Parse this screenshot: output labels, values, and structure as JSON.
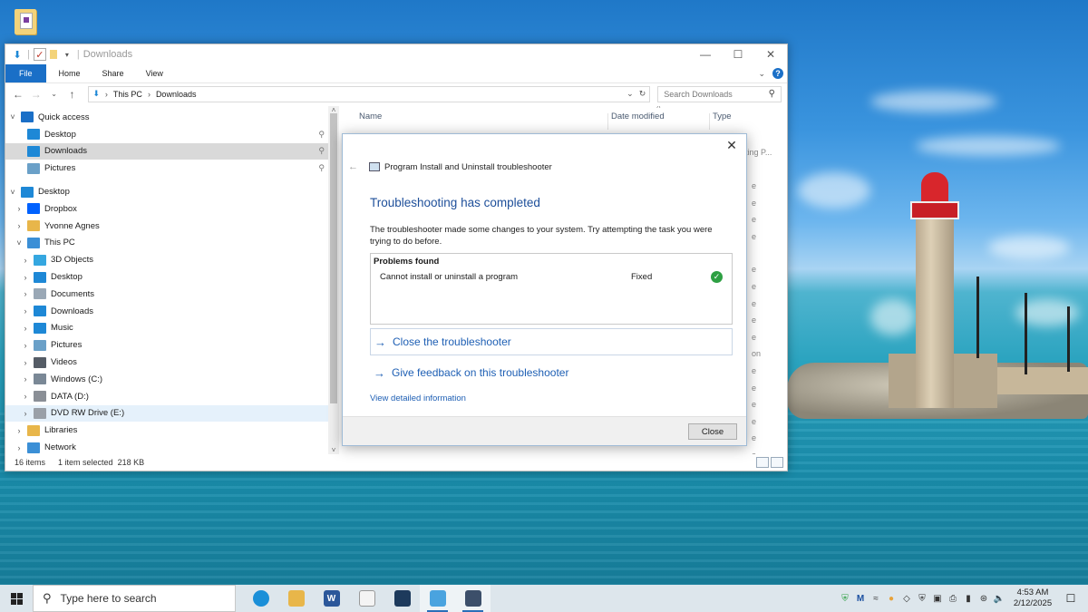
{
  "explorer": {
    "title": "Downloads",
    "ribbon_tabs": [
      "File",
      "Home",
      "Share",
      "View"
    ],
    "breadcrumb": [
      "This PC",
      "Downloads"
    ],
    "search_placeholder": "Search Downloads",
    "nav_items": [
      {
        "label": "Quick access",
        "icon": "star-icon",
        "color": "#1a6fc7",
        "indent": 0,
        "chevron": "v",
        "state": ""
      },
      {
        "label": "Desktop",
        "icon": "desktop-icon",
        "color": "#1e88d6",
        "indent": 1,
        "chevron": "",
        "state": "",
        "pinned": true
      },
      {
        "label": "Downloads",
        "icon": "download-icon",
        "color": "#1e88d6",
        "indent": 1,
        "chevron": "",
        "state": "selected",
        "pinned": true
      },
      {
        "label": "Pictures",
        "icon": "pictures-icon",
        "color": "#6aa0c8",
        "indent": 1,
        "chevron": "",
        "state": "",
        "pinned": true
      },
      {
        "label": "Desktop",
        "icon": "desktop-icon",
        "color": "#1e88d6",
        "indent": 0,
        "chevron": "v",
        "state": ""
      },
      {
        "label": "Dropbox",
        "icon": "dropbox-icon",
        "color": "#0061fe",
        "indent": 1,
        "chevron": ">",
        "state": ""
      },
      {
        "label": "Yvonne Agnes",
        "icon": "user-folder-icon",
        "color": "#e8b64a",
        "indent": 1,
        "chevron": ">",
        "state": ""
      },
      {
        "label": "This PC",
        "icon": "computer-icon",
        "color": "#3b8fd6",
        "indent": 1,
        "chevron": "v",
        "state": ""
      },
      {
        "label": "3D Objects",
        "icon": "cube-icon",
        "color": "#35a7e0",
        "indent": 2,
        "chevron": ">",
        "state": ""
      },
      {
        "label": "Desktop",
        "icon": "desktop-icon",
        "color": "#1e88d6",
        "indent": 2,
        "chevron": ">",
        "state": ""
      },
      {
        "label": "Documents",
        "icon": "documents-icon",
        "color": "#9aa8b6",
        "indent": 2,
        "chevron": ">",
        "state": ""
      },
      {
        "label": "Downloads",
        "icon": "download-icon",
        "color": "#1e88d6",
        "indent": 2,
        "chevron": ">",
        "state": ""
      },
      {
        "label": "Music",
        "icon": "music-icon",
        "color": "#1e88d6",
        "indent": 2,
        "chevron": ">",
        "state": ""
      },
      {
        "label": "Pictures",
        "icon": "pictures-icon",
        "color": "#6aa0c8",
        "indent": 2,
        "chevron": ">",
        "state": ""
      },
      {
        "label": "Videos",
        "icon": "videos-icon",
        "color": "#555c66",
        "indent": 2,
        "chevron": ">",
        "state": ""
      },
      {
        "label": "Windows (C:)",
        "icon": "drive-icon",
        "color": "#7a8896",
        "indent": 2,
        "chevron": ">",
        "state": ""
      },
      {
        "label": "DATA (D:)",
        "icon": "drive-icon",
        "color": "#8a8f96",
        "indent": 2,
        "chevron": ">",
        "state": ""
      },
      {
        "label": "DVD RW Drive (E:)",
        "icon": "dvd-drive-icon",
        "color": "#9aa0a8",
        "indent": 2,
        "chevron": ">",
        "state": "hover"
      },
      {
        "label": "Libraries",
        "icon": "libraries-icon",
        "color": "#e8b64a",
        "indent": 1,
        "chevron": ">",
        "state": ""
      },
      {
        "label": "Network",
        "icon": "network-icon",
        "color": "#3b8fd6",
        "indent": 1,
        "chevron": ">",
        "state": ""
      }
    ],
    "columns": [
      "Name",
      "Date modified",
      "Type"
    ],
    "partial_type_text": "oting P...",
    "partial_type_glyphs": [
      "e",
      "e",
      "e",
      "e",
      "e",
      "e",
      "e",
      "e",
      "e",
      "on",
      "e",
      "e",
      "e",
      "e",
      "e",
      "e",
      "e"
    ],
    "status": {
      "items": "16 items",
      "selected": "1 item selected",
      "size": "218 KB"
    }
  },
  "dialog": {
    "window_title": "Program Install and Uninstall troubleshooter",
    "heading": "Troubleshooting has completed",
    "description": "The troubleshooter made some changes to your system. Try attempting the task you were trying to do before.",
    "problems_header": "Problems found",
    "problems": [
      {
        "name": "Cannot install or uninstall a program",
        "status": "Fixed"
      }
    ],
    "link_close": "Close the troubleshooter",
    "link_feedback": "Give feedback on this troubleshooter",
    "link_details": "View detailed information",
    "close_button": "Close"
  },
  "taskbar": {
    "search_placeholder": "Type here to search",
    "apps": [
      {
        "name": "edge-icon",
        "color": "#1a8fd8",
        "active": false
      },
      {
        "name": "file-explorer-icon",
        "color": "#e8b64a",
        "active": false
      },
      {
        "name": "word-icon",
        "color": "#2b579a",
        "glyph": "W",
        "active": false
      },
      {
        "name": "notepad-icon",
        "color": "#f4f4f4",
        "active": false
      },
      {
        "name": "app-icon",
        "color": "#1d3a5c",
        "active": false
      },
      {
        "name": "remote-desktop-icon",
        "color": "#4aa3df",
        "active": true
      },
      {
        "name": "troubleshooter-icon",
        "color": "#3c4f6a",
        "active": true
      }
    ],
    "time": "4:53 AM",
    "date": "2/12/2025"
  }
}
